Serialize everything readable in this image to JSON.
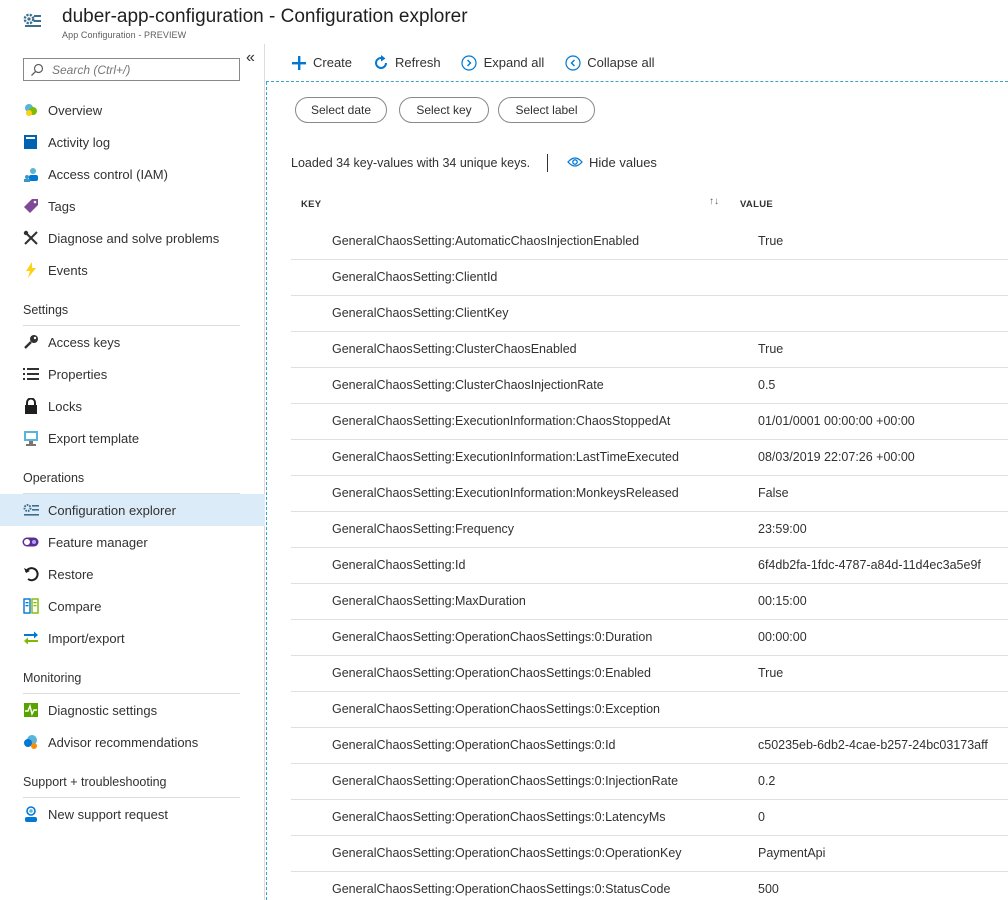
{
  "header": {
    "title": "duber-app-configuration - Configuration explorer",
    "subtitle": "App Configuration - PREVIEW"
  },
  "sidebar": {
    "search_placeholder": "Search (Ctrl+/)",
    "collapse_glyph": "«",
    "groups": [
      {
        "section": "",
        "items": [
          {
            "label": "Overview",
            "icon": "overview-icon"
          },
          {
            "label": "Activity log",
            "icon": "activity-log-icon"
          },
          {
            "label": "Access control (IAM)",
            "icon": "access-control-icon"
          },
          {
            "label": "Tags",
            "icon": "tag-icon"
          },
          {
            "label": "Diagnose and solve problems",
            "icon": "wrench-icon"
          },
          {
            "label": "Events",
            "icon": "lightning-icon"
          }
        ]
      },
      {
        "section": "Settings",
        "items": [
          {
            "label": "Access keys",
            "icon": "key-icon"
          },
          {
            "label": "Properties",
            "icon": "properties-icon"
          },
          {
            "label": "Locks",
            "icon": "lock-icon"
          },
          {
            "label": "Export template",
            "icon": "export-template-icon"
          }
        ]
      },
      {
        "section": "Operations",
        "items": [
          {
            "label": "Configuration explorer",
            "icon": "config-explorer-icon",
            "active": true
          },
          {
            "label": "Feature manager",
            "icon": "feature-toggle-icon"
          },
          {
            "label": "Restore",
            "icon": "restore-icon"
          },
          {
            "label": "Compare",
            "icon": "compare-icon"
          },
          {
            "label": "Import/export",
            "icon": "import-export-icon"
          }
        ]
      },
      {
        "section": "Monitoring",
        "items": [
          {
            "label": "Diagnostic settings",
            "icon": "diagnostic-icon"
          },
          {
            "label": "Advisor recommendations",
            "icon": "advisor-icon"
          }
        ]
      },
      {
        "section": "Support + troubleshooting",
        "items": [
          {
            "label": "New support request",
            "icon": "support-icon"
          }
        ]
      }
    ]
  },
  "toolbar": {
    "create": "Create",
    "refresh": "Refresh",
    "expand_all": "Expand all",
    "collapse_all": "Collapse all"
  },
  "filters": {
    "select_date": "Select date",
    "select_key": "Select key",
    "select_label": "Select label"
  },
  "status": {
    "loaded": "Loaded 34 key-values with 34 unique keys.",
    "hide_values": "Hide values"
  },
  "table": {
    "col_key": "KEY",
    "col_value": "VALUE",
    "sort_glyph": "↑↓",
    "rows": [
      {
        "key": "GeneralChaosSetting:AutomaticChaosInjectionEnabled",
        "value": "True"
      },
      {
        "key": "GeneralChaosSetting:ClientId",
        "value": ""
      },
      {
        "key": "GeneralChaosSetting:ClientKey",
        "value": ""
      },
      {
        "key": "GeneralChaosSetting:ClusterChaosEnabled",
        "value": "True"
      },
      {
        "key": "GeneralChaosSetting:ClusterChaosInjectionRate",
        "value": "0.5"
      },
      {
        "key": "GeneralChaosSetting:ExecutionInformation:ChaosStoppedAt",
        "value": "01/01/0001 00:00:00 +00:00"
      },
      {
        "key": "GeneralChaosSetting:ExecutionInformation:LastTimeExecuted",
        "value": "08/03/2019 22:07:26 +00:00"
      },
      {
        "key": "GeneralChaosSetting:ExecutionInformation:MonkeysReleased",
        "value": "False"
      },
      {
        "key": "GeneralChaosSetting:Frequency",
        "value": "23:59:00"
      },
      {
        "key": "GeneralChaosSetting:Id",
        "value": "6f4db2fa-1fdc-4787-a84d-11d4ec3a5e9f"
      },
      {
        "key": "GeneralChaosSetting:MaxDuration",
        "value": "00:15:00"
      },
      {
        "key": "GeneralChaosSetting:OperationChaosSettings:0:Duration",
        "value": "00:00:00"
      },
      {
        "key": "GeneralChaosSetting:OperationChaosSettings:0:Enabled",
        "value": "True"
      },
      {
        "key": "GeneralChaosSetting:OperationChaosSettings:0:Exception",
        "value": ""
      },
      {
        "key": "GeneralChaosSetting:OperationChaosSettings:0:Id",
        "value": "c50235eb-6db2-4cae-b257-24bc03173aff"
      },
      {
        "key": "GeneralChaosSetting:OperationChaosSettings:0:InjectionRate",
        "value": "0.2"
      },
      {
        "key": "GeneralChaosSetting:OperationChaosSettings:0:LatencyMs",
        "value": "0"
      },
      {
        "key": "GeneralChaosSetting:OperationChaosSettings:0:OperationKey",
        "value": "PaymentApi"
      },
      {
        "key": "GeneralChaosSetting:OperationChaosSettings:0:StatusCode",
        "value": "500"
      }
    ]
  },
  "colors": {
    "accent": "#0078d4",
    "active_bg": "#dcebf8",
    "dashed_border": "#3aa3c9"
  }
}
